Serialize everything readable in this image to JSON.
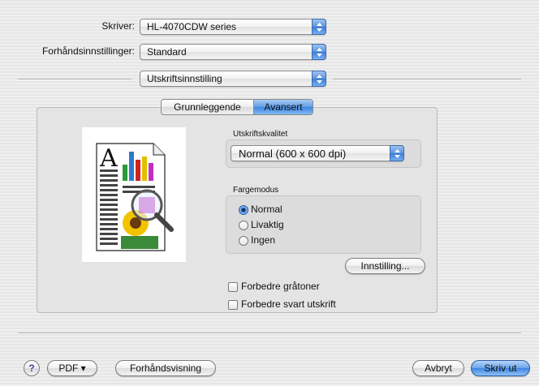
{
  "printer": {
    "label": "Skriver:",
    "value": "HL-4070CDW series"
  },
  "presets": {
    "label": "Forhåndsinnstillinger:",
    "value": "Standard"
  },
  "panel_popup": {
    "value": "Utskriftsinnstilling"
  },
  "tabs": [
    {
      "label": "Grunnleggende",
      "selected": false
    },
    {
      "label": "Avansert",
      "selected": true
    }
  ],
  "quality": {
    "label": "Utskriftskvalitet",
    "value": "Normal (600 x 600 dpi)"
  },
  "color_mode": {
    "label": "Fargemodus",
    "options": [
      {
        "label": "Normal",
        "selected": true
      },
      {
        "label": "Livaktig",
        "selected": false
      },
      {
        "label": "Ingen",
        "selected": false
      }
    ],
    "settings_button": "Innstilling..."
  },
  "checkboxes": [
    {
      "label": "Forbedre gråtoner",
      "checked": false
    },
    {
      "label": "Forbedre svart utskrift",
      "checked": false
    }
  ],
  "footer": {
    "help": "?",
    "pdf": "PDF ▾",
    "preview": "Forhåndsvisning",
    "cancel": "Avbryt",
    "print": "Skriv ut"
  },
  "colors": {
    "accent": "#3f86e0"
  }
}
